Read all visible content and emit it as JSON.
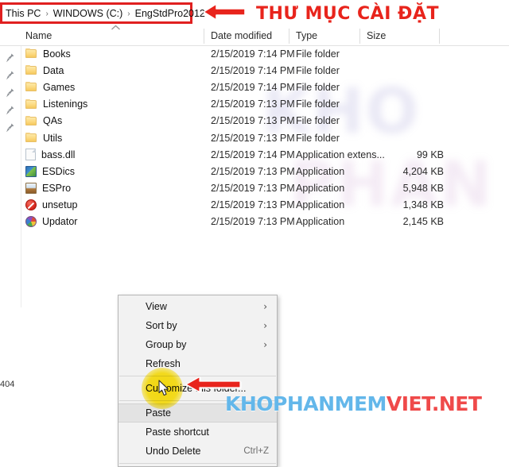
{
  "window": {
    "breadcrumb": [
      {
        "label": "This PC"
      },
      {
        "label": "WINDOWS (C:)"
      },
      {
        "label": "EngStdPro2012"
      }
    ],
    "breadcrumb_separator": "›"
  },
  "columns": {
    "name": "Name",
    "date_modified": "Date modified",
    "type": "Type",
    "size": "Size",
    "sort_indicator": "˄"
  },
  "files": [
    {
      "name": "Books",
      "icon": "folder-icon",
      "date": "2/15/2019 7:14 PM",
      "type": "File folder",
      "size": ""
    },
    {
      "name": "Data",
      "icon": "folder-icon",
      "date": "2/15/2019 7:14 PM",
      "type": "File folder",
      "size": ""
    },
    {
      "name": "Games",
      "icon": "folder-icon",
      "date": "2/15/2019 7:14 PM",
      "type": "File folder",
      "size": ""
    },
    {
      "name": "Listenings",
      "icon": "folder-icon",
      "date": "2/15/2019 7:13 PM",
      "type": "File folder",
      "size": ""
    },
    {
      "name": "QAs",
      "icon": "folder-icon",
      "date": "2/15/2019 7:13 PM",
      "type": "File folder",
      "size": ""
    },
    {
      "name": "Utils",
      "icon": "folder-icon",
      "date": "2/15/2019 7:13 PM",
      "type": "File folder",
      "size": ""
    },
    {
      "name": "bass.dll",
      "icon": "dll-file-icon",
      "date": "2/15/2019 7:14 PM",
      "type": "Application extens...",
      "size": "99 KB"
    },
    {
      "name": "ESDics",
      "icon": "esdics-app-icon",
      "date": "2/15/2019 7:13 PM",
      "type": "Application",
      "size": "4,204 KB"
    },
    {
      "name": "ESPro",
      "icon": "espro-app-icon",
      "date": "2/15/2019 7:13 PM",
      "type": "Application",
      "size": "5,948 KB"
    },
    {
      "name": "unsetup",
      "icon": "unsetup-app-icon",
      "date": "2/15/2019 7:13 PM",
      "type": "Application",
      "size": "1,348 KB"
    },
    {
      "name": "Updator",
      "icon": "updator-app-icon",
      "date": "2/15/2019 7:13 PM",
      "type": "Application",
      "size": "2,145 KB"
    }
  ],
  "context_menu": {
    "items": [
      {
        "label": "View",
        "submenu": true,
        "shortcut": "",
        "highlight": false
      },
      {
        "label": "Sort by",
        "submenu": true,
        "shortcut": "",
        "highlight": false
      },
      {
        "label": "Group by",
        "submenu": true,
        "shortcut": "",
        "highlight": false
      },
      {
        "label": "Refresh",
        "submenu": false,
        "shortcut": "",
        "highlight": false
      },
      {
        "label": "Customize this folder...",
        "submenu": false,
        "shortcut": "",
        "highlight": false
      },
      {
        "label": "Paste",
        "submenu": false,
        "shortcut": "",
        "highlight": true
      },
      {
        "label": "Paste shortcut",
        "submenu": false,
        "shortcut": "",
        "highlight": false
      },
      {
        "label": "Undo Delete",
        "submenu": false,
        "shortcut": "Ctrl+Z",
        "highlight": false
      }
    ],
    "submenu_arrow": "›"
  },
  "annotations": {
    "top_label": "THƯ MỤC CÀI ĐẶT",
    "top_arrow": "left-arrow-icon",
    "paste_arrow": "left-arrow-icon",
    "highlight_target": "Paste",
    "accent_red": "#e02020",
    "text_red": "#e8241c"
  },
  "watermark": {
    "background_line1": "KHO",
    "background_line2": "PHAN",
    "site_blue": "KHOPHANMEM",
    "site_red": "VIET.NET"
  },
  "stray": {
    "bottom_left": "404"
  },
  "nav_pane": {
    "pin_icon": "pin-icon",
    "pin_count": 5
  }
}
